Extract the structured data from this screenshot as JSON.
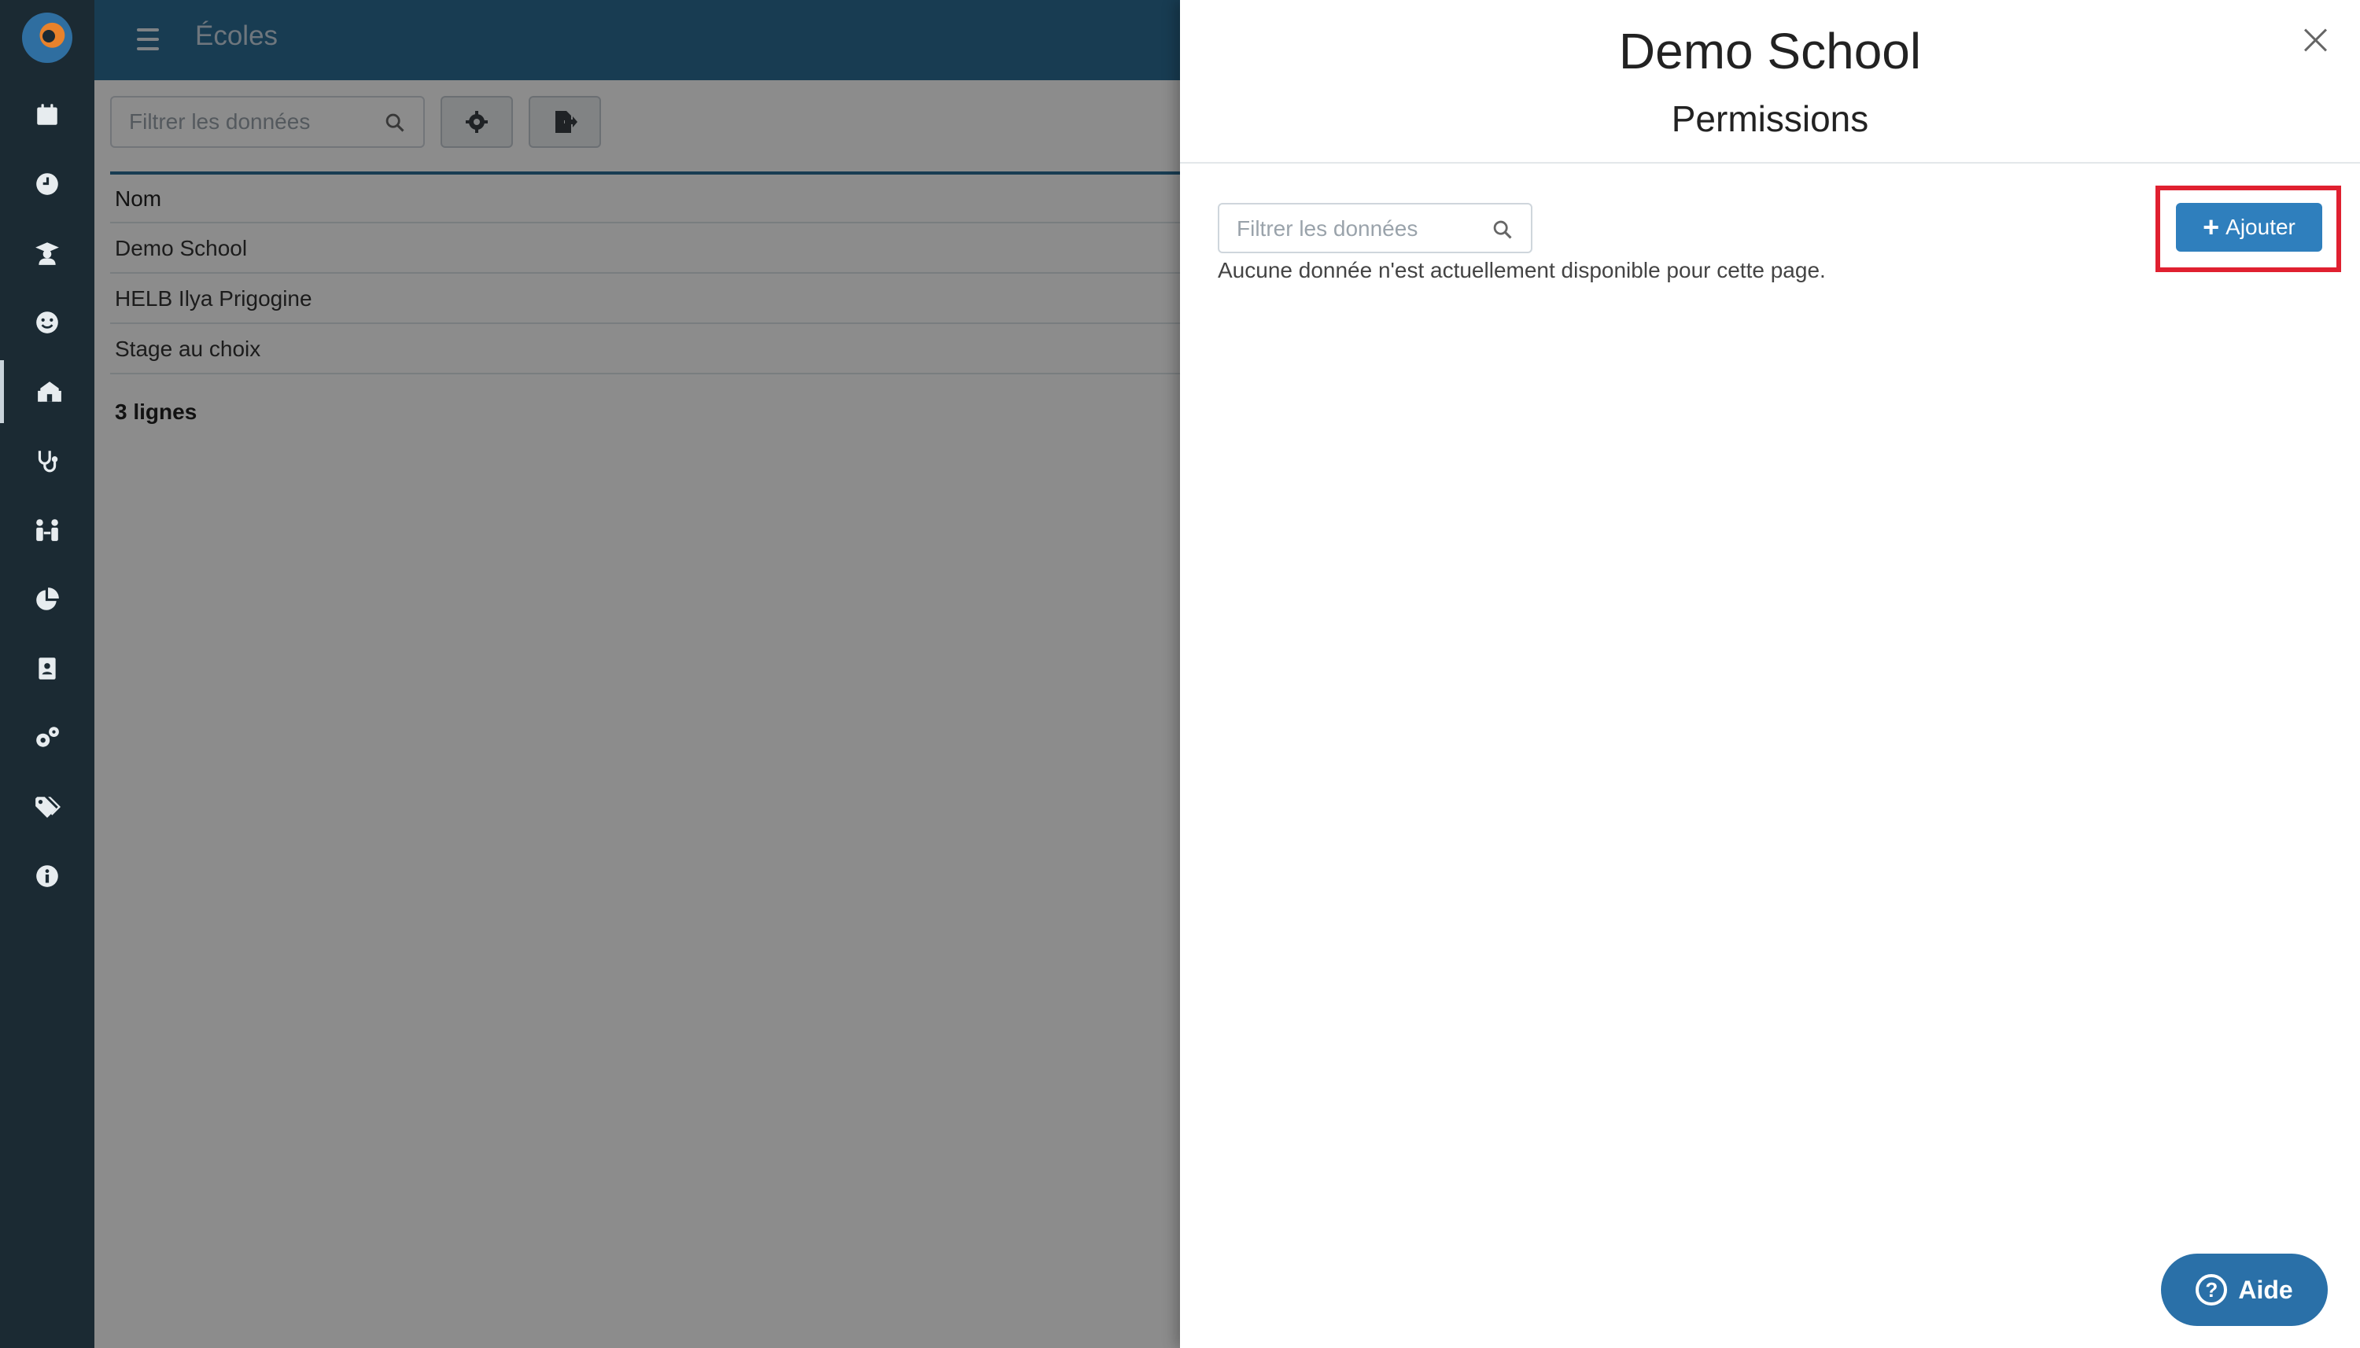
{
  "app": {
    "page_title": "Écoles",
    "colors": {
      "sidebar": "#1b2a33",
      "topbar": "#2c6d96",
      "accent": "#2f7fbd",
      "highlight": "#e02030"
    }
  },
  "sidebar": {
    "items": [
      {
        "icon": "calendar-icon"
      },
      {
        "icon": "clock-icon"
      },
      {
        "icon": "graduate-icon"
      },
      {
        "icon": "smiley-icon"
      },
      {
        "icon": "school-icon",
        "active": true
      },
      {
        "icon": "stethoscope-icon"
      },
      {
        "icon": "people-connection-icon"
      },
      {
        "icon": "pie-chart-icon"
      },
      {
        "icon": "contact-card-icon"
      },
      {
        "icon": "gears-icon"
      },
      {
        "icon": "tags-icon"
      },
      {
        "icon": "info-icon"
      }
    ]
  },
  "main": {
    "filter_placeholder": "Filtrer les données",
    "table": {
      "header": "Nom",
      "rows": [
        "Demo School",
        "HELB Ilya Prigogine",
        "Stage au choix"
      ]
    },
    "row_count": "3 lignes"
  },
  "drawer": {
    "title": "Demo School",
    "subtitle": "Permissions",
    "filter_placeholder": "Filtrer les données",
    "empty_message": "Aucune donnée n'est actuellement disponible pour cette page.",
    "add_label": "Ajouter",
    "help_label": "Aide"
  }
}
